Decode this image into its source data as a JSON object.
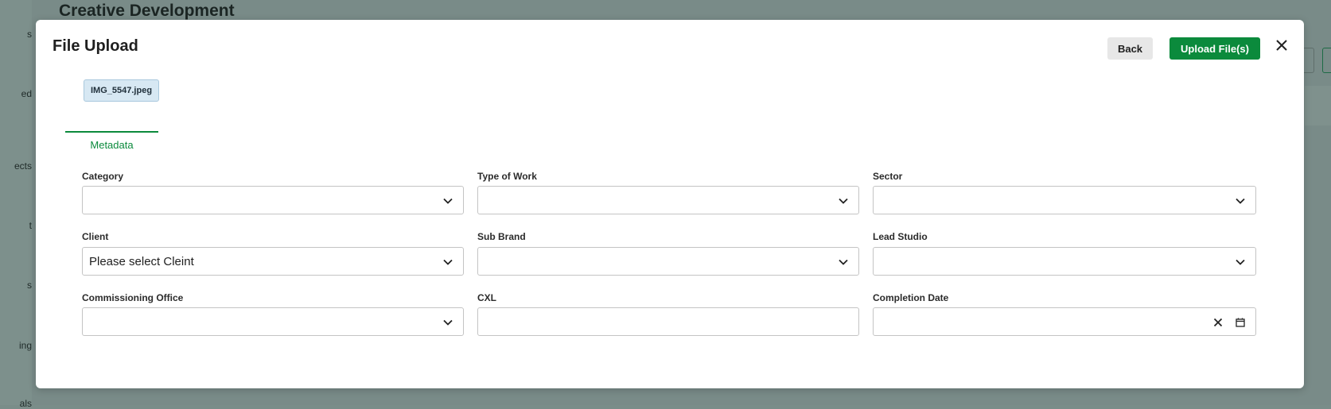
{
  "background": {
    "page_title": "Creative Development",
    "sidebar_fragments": [
      "s",
      "ed",
      "ects",
      "t",
      "s",
      "ing",
      "als"
    ]
  },
  "modal": {
    "title": "File Upload",
    "back_label": "Back",
    "upload_label": "Upload File(s)",
    "close_icon": "close-icon",
    "file_chip": "IMG_5547.jpeg",
    "tabs": [
      {
        "label": "Metadata",
        "active": true
      }
    ]
  },
  "form": {
    "category": {
      "label": "Category",
      "value": ""
    },
    "type_of_work": {
      "label": "Type of Work",
      "value": ""
    },
    "sector": {
      "label": "Sector",
      "value": ""
    },
    "client": {
      "label": "Client",
      "value": "Please select Cleint"
    },
    "sub_brand": {
      "label": "Sub Brand",
      "value": ""
    },
    "lead_studio": {
      "label": "Lead Studio",
      "value": ""
    },
    "commissioning_office": {
      "label": "Commissioning Office",
      "value": ""
    },
    "cxl": {
      "label": "CXL",
      "value": ""
    },
    "completion_date": {
      "label": "Completion Date",
      "value": ""
    }
  },
  "colors": {
    "accent_green": "#0b8a3c",
    "overlay": "#7a8d89",
    "chip_bg": "#d7e8f3"
  }
}
